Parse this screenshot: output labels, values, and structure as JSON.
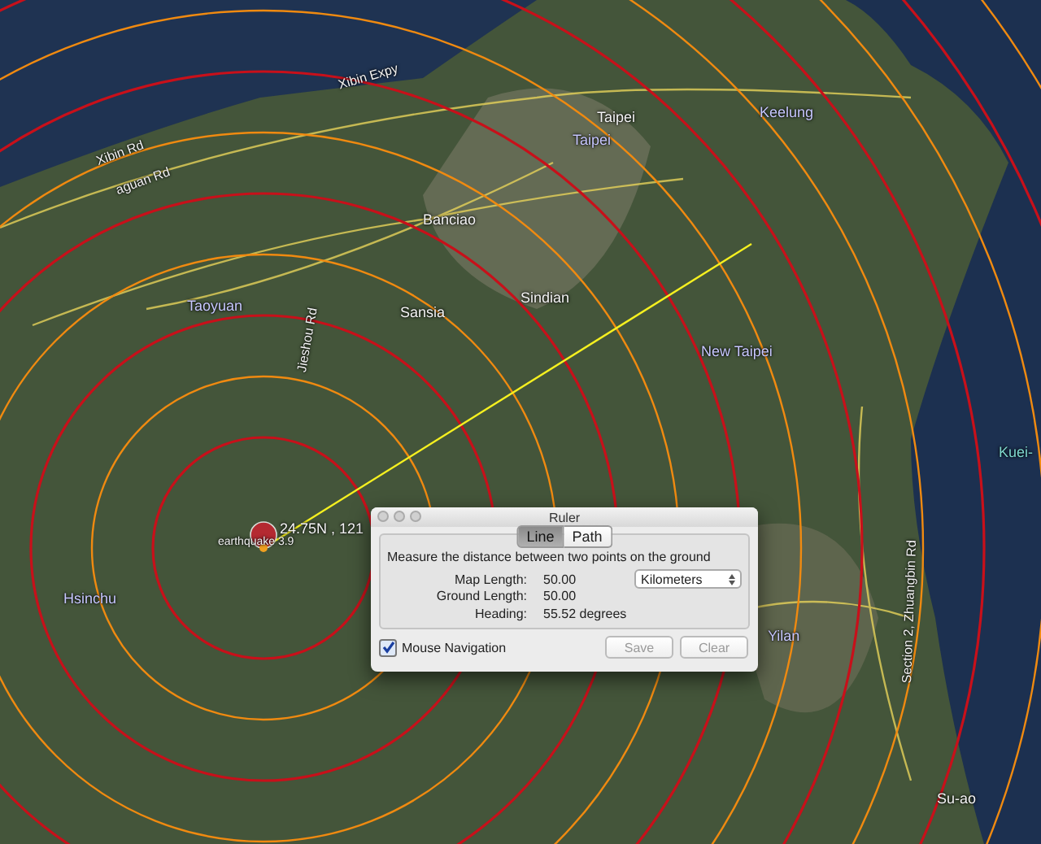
{
  "map": {
    "labels": [
      {
        "text": "Xibin Expy",
        "kind": "road"
      },
      {
        "text": "Xibin Rd",
        "kind": "road"
      },
      {
        "text": "aguan Rd",
        "kind": "road"
      },
      {
        "text": "Banciao",
        "kind": "city"
      },
      {
        "text": "Taoyuan",
        "kind": "region"
      },
      {
        "text": "Jieshou Rd",
        "kind": "road"
      },
      {
        "text": "Sansia",
        "kind": "city"
      },
      {
        "text": "Taipei",
        "kind": "city"
      },
      {
        "text": "Taipei",
        "kind": "region"
      },
      {
        "text": "Keelung",
        "kind": "region"
      },
      {
        "text": "Sindian",
        "kind": "city"
      },
      {
        "text": "New Taipei",
        "kind": "region"
      },
      {
        "text": "Hsinchu",
        "kind": "region"
      },
      {
        "text": "Yilan",
        "kind": "region"
      },
      {
        "text": "Section 2, Zhuangbin Rd",
        "kind": "road"
      },
      {
        "text": "Su-ao",
        "kind": "city"
      },
      {
        "text": "Kuei-",
        "kind": "sea"
      }
    ],
    "placemark": {
      "coordinates": "24.75N , 121",
      "name": "earthquake 3.9"
    }
  },
  "ruler": {
    "title": "Ruler",
    "tabs": [
      {
        "label": "Line",
        "selected": true
      },
      {
        "label": "Path",
        "selected": false
      }
    ],
    "instruction": "Measure the distance between two points on the ground",
    "rows": [
      {
        "label": "Map Length:",
        "value": "50.00",
        "unit": "Kilometers"
      },
      {
        "label": "Ground Length:",
        "value": "50.00"
      },
      {
        "label": "Heading:",
        "value": "55.52 degrees"
      }
    ],
    "mouse_navigation": {
      "label": "Mouse Navigation",
      "checked": true
    },
    "buttons": [
      {
        "label": "Save",
        "disabled": true
      },
      {
        "label": "Clear",
        "disabled": true
      }
    ]
  }
}
